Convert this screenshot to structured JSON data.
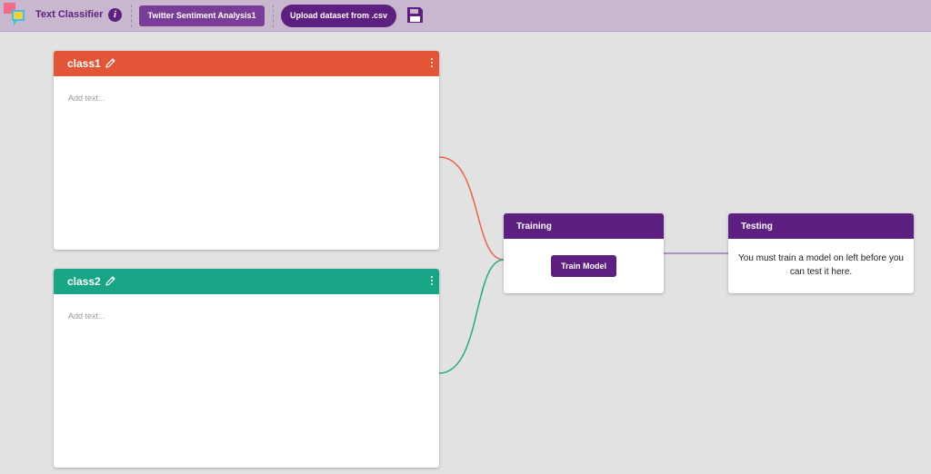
{
  "header": {
    "app_title": "Text Classifier",
    "info_icon": "info-icon",
    "project_name": "Twitter Sentiment Analysis1",
    "upload_label": "Upload dataset from .csv",
    "save_icon": "floppy-disk-icon"
  },
  "classes": [
    {
      "name": "class1",
      "placeholder": "Add text...",
      "color": "#e25537"
    },
    {
      "name": "class2",
      "placeholder": "Add text...",
      "color": "#17a586"
    }
  ],
  "training": {
    "title": "Training",
    "button_label": "Train Model"
  },
  "testing": {
    "title": "Testing",
    "message": "You must train a model on left before you can test it here."
  },
  "colors": {
    "accent": "#5d1f80",
    "topbar": "#c9b6cf",
    "background": "#e2e2e2"
  }
}
